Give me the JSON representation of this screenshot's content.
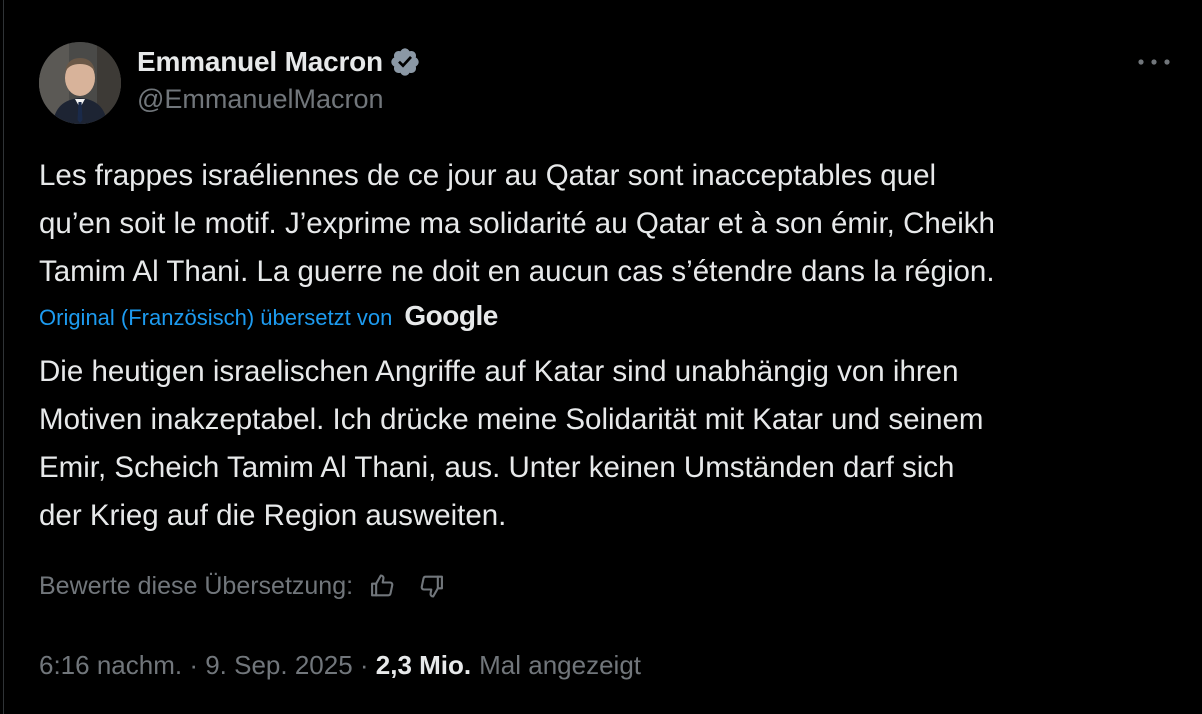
{
  "author": {
    "display_name": "Emmanuel Macron",
    "handle": "@EmmanuelMacron",
    "verified": true,
    "avatar_alt": "avatar"
  },
  "tweet": {
    "original_text": "Les frappes israéliennes de ce jour au Qatar sont inacceptables quel\nqu’en soit le motif. J’exprime ma solidarité au Qatar et à son émir, Cheikh\nTamim Al Thani. La guerre ne doit en aucun cas s’étendre dans la région.",
    "translation_label": "Original (Französisch) übersetzt von",
    "translation_provider": "Google",
    "translated_text": "Die heutigen israelischen Angriffe auf Katar sind unabhängig von ihren\nMotiven inakzeptabel. Ich drücke meine Solidarität mit Katar und seinem\nEmir, Scheich Tamim Al Thani, aus. Unter keinen Umständen darf sich\nder Krieg auf die Region ausweiten.",
    "rate_label": "Bewerte diese Übersetzung:"
  },
  "meta": {
    "time": "6:16 nachm.",
    "separator": " · ",
    "date": "9. Sep. 2025",
    "views": "2,3 Mio.",
    "views_label": "Mal angezeigt"
  },
  "icons": {
    "verified": "verified-badge-icon",
    "more": "more-options-icon",
    "thumbs_up": "thumbs-up-icon",
    "thumbs_down": "thumbs-down-icon"
  },
  "colors": {
    "background": "#000000",
    "text_primary": "#e7e9ea",
    "text_secondary": "#71767b",
    "accent": "#1d9bf0"
  }
}
